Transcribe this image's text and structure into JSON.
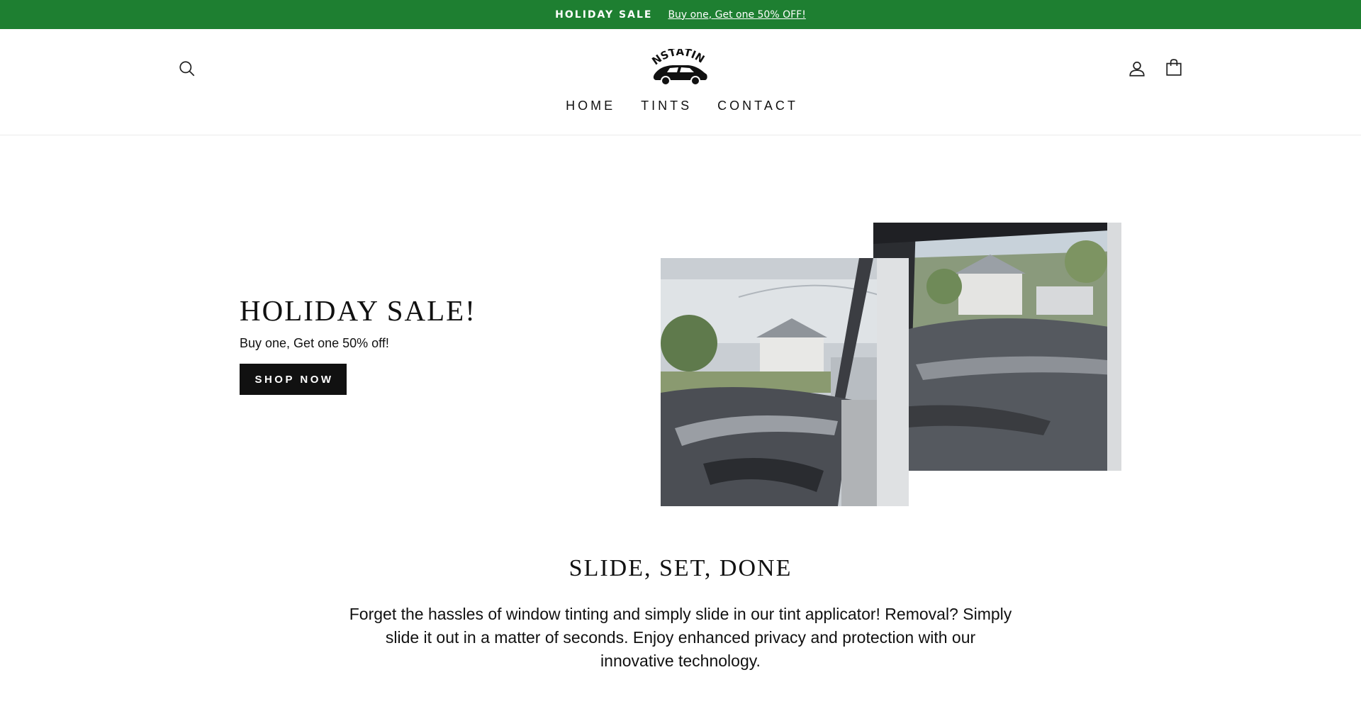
{
  "announcement": {
    "title": "HOLIDAY SALE",
    "link_text": "Buy one, Get one 50% OFF!",
    "bg_color": "#1e7f31"
  },
  "header": {
    "logo_text": "INSTATINT",
    "icons": {
      "search": "search-icon",
      "account": "user-icon",
      "cart": "bag-icon"
    },
    "nav": [
      "HOME",
      "TINTS",
      "CONTACT"
    ]
  },
  "hero": {
    "title": "HOLIDAY SALE!",
    "subtitle": "Buy one, Get one 50% off!",
    "button_label": "SHOP NOW"
  },
  "feature": {
    "title": "SLIDE, SET, DONE",
    "body": "Forget the hassles of window tinting and simply slide in our tint applicator! Removal? Simply slide it out in a matter of seconds. Enjoy enhanced privacy and protection with our innovative technology."
  }
}
